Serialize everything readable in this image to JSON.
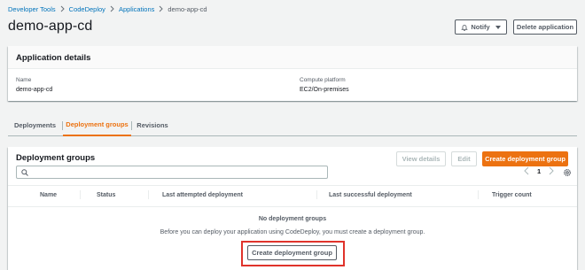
{
  "breadcrumb": {
    "items": [
      "Developer Tools",
      "CodeDeploy",
      "Applications"
    ],
    "current": "demo-app-cd"
  },
  "header": {
    "title": "demo-app-cd",
    "notify_label": "Notify",
    "delete_label": "Delete application"
  },
  "details": {
    "title": "Application details",
    "name_label": "Name",
    "name_value": "demo-app-cd",
    "platform_label": "Compute platform",
    "platform_value": "EC2/On-premises"
  },
  "tabs": [
    {
      "label": "Deployments",
      "active": false
    },
    {
      "label": "Deployment groups",
      "active": true
    },
    {
      "label": "Revisions",
      "active": false
    }
  ],
  "groups": {
    "title": "Deployment groups",
    "view_details_label": "View details",
    "edit_label": "Edit",
    "create_label": "Create deployment group",
    "page_number": "1",
    "search_placeholder": "",
    "columns": [
      "Name",
      "Status",
      "Last attempted deployment",
      "Last successful deployment",
      "Trigger count"
    ],
    "empty_title": "No deployment groups",
    "empty_desc": "Before you can deploy your application using CodeDeploy, you must create a deployment group.",
    "empty_create_label": "Create deployment group"
  },
  "colors": {
    "accent": "#ec7211",
    "link": "#0073bb",
    "highlight": "#e0332b"
  }
}
